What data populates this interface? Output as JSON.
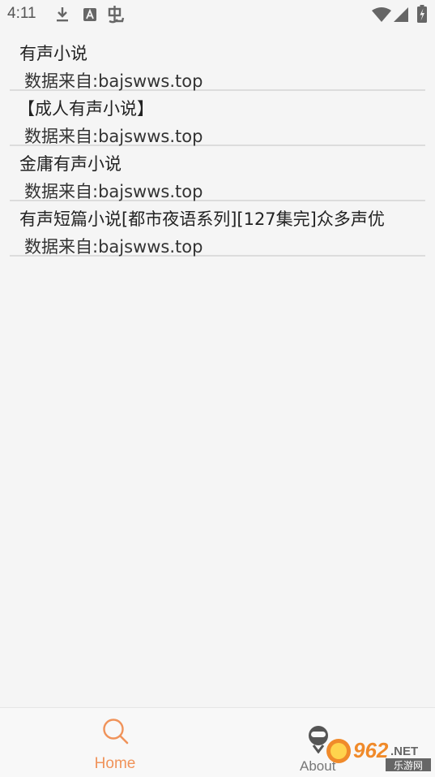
{
  "status_bar": {
    "time": "4:11",
    "icons": [
      "download-icon",
      "text-a-icon",
      "bug-icon",
      "wifi-icon",
      "signal-icon",
      "battery-charging-icon"
    ]
  },
  "list": {
    "items": [
      {
        "title": "有声小说",
        "source": "数据来自:bajswws.top"
      },
      {
        "title": "【成人有声小说】",
        "source": "数据来自:bajswws.top"
      },
      {
        "title": "金庸有声小说",
        "source": "数据来自:bajswws.top"
      },
      {
        "title": "有声短篇小说[都市夜语系列][127集完]众多声优",
        "source": "数据来自:bajswws.top"
      }
    ]
  },
  "bottom_nav": {
    "home_label": "Home",
    "about_label": "About",
    "active_color": "#f0935a",
    "inactive_color": "#777777"
  },
  "watermark": {
    "logo_text": "962.NET",
    "sub_text": "乐游网"
  }
}
